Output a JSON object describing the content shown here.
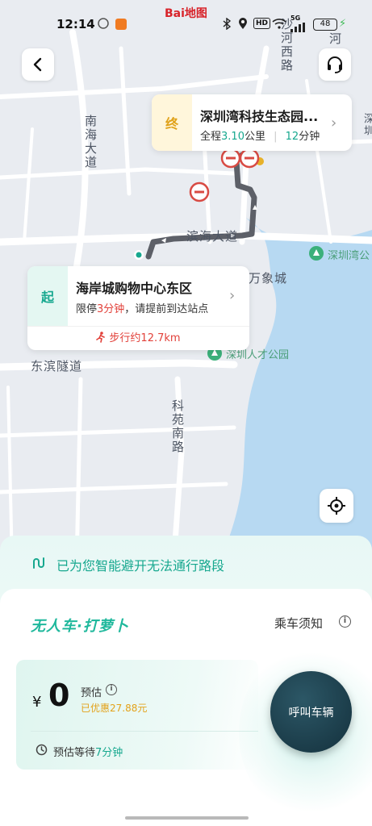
{
  "status_bar": {
    "time": "12:14",
    "brand": "Bai地图",
    "signal": "5G",
    "hd": "HD",
    "battery": "48"
  },
  "map": {
    "labels": {
      "nanhai_dadao": "南海大道",
      "shahe_xilu": "沙河西路",
      "binhai_dadao": "滨海大道",
      "wanxiangcheng": "万象城",
      "dongbin_tunnel": "东滨隧道",
      "rencai_park": "深圳人才公园",
      "shenzhenwan_park": "深圳湾公",
      "keyuan_nanlu": "科苑南路",
      "he": "河",
      "shenzhen": "深圳"
    }
  },
  "destination": {
    "badge": "终",
    "name": "深圳湾科技生态园...",
    "distance_prefix": "全程",
    "distance_value": "3.10",
    "distance_unit": "公里",
    "duration_value": "12",
    "duration_unit": "分钟"
  },
  "start": {
    "badge": "起",
    "name": "海岸城购物中心东区",
    "note_prefix": "限停",
    "note_minutes": "3分钟",
    "note_suffix": "，请提前到达站点",
    "walk_text": "步行约12.7km"
  },
  "sheet": {
    "avoid_text": "已为您智能避开无法通行路段",
    "brand_logo": "无人车·打萝卜",
    "notice_label": "乘车须知",
    "price": {
      "currency": "¥",
      "amount": "0",
      "estimate_label": "预估",
      "discount": "已优惠27.88元",
      "wait_prefix": "预估等待",
      "wait_value": "7分钟"
    },
    "call_button": "呼叫车辆"
  },
  "colors": {
    "accent_teal": "#17a88f",
    "route_gray": "#5d6068",
    "water": "#b7d9f2",
    "call_button_bg": "#1b3c49",
    "discount": "#e3a21a",
    "warning_red": "#e2413a"
  }
}
